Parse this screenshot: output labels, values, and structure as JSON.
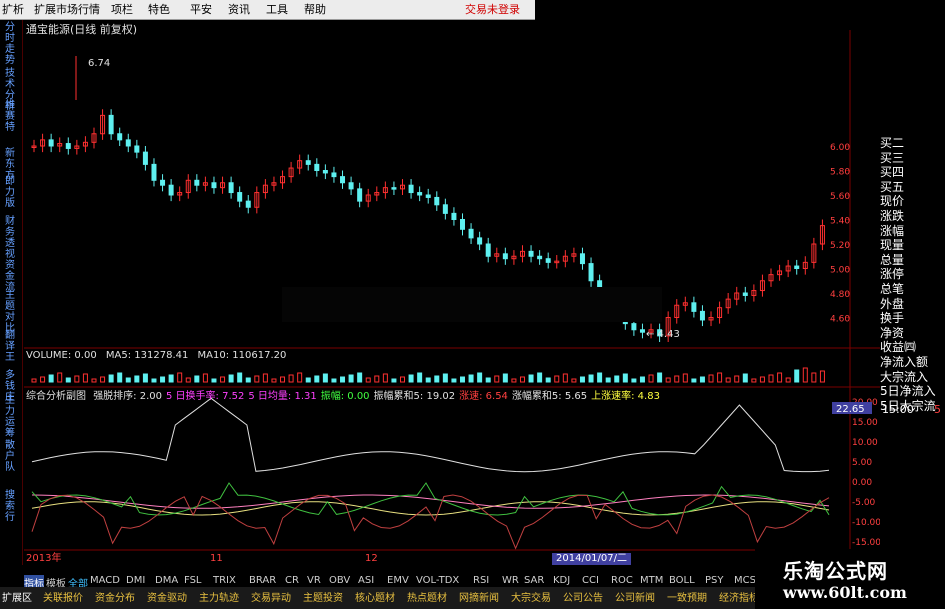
{
  "menubar": {
    "items": [
      "扩析",
      "扩展市场行情",
      "项栏",
      "特色",
      "平安",
      "资讯",
      "工具",
      "帮助"
    ],
    "trade_status": "交易未登录"
  },
  "left_tabs": [
    "分时走势",
    "技术分析",
    "维赛特",
    "新东方",
    "即力版",
    "财务透视",
    "资金流",
    "主题对比",
    "翻译王",
    "多钱庄",
    "主力运筹",
    "散户队",
    "搜索行"
  ],
  "stock": {
    "title": "通宝能源(日线 前复权)"
  },
  "price_chart": {
    "high_label": "6.74",
    "low_label": "4.43",
    "price_ticks": [
      "6.00",
      "5.80",
      "5.60",
      "5.40",
      "5.20",
      "5.00",
      "4.80",
      "4.60"
    ]
  },
  "volume_header": {
    "volume": "VOLUME: 0.00",
    "ma5": "MA5: 131278.41",
    "ma10": "MA10: 110617.20"
  },
  "indicator_header": {
    "name": "综合分析副图",
    "items": [
      "强脱排序: 2.00",
      "5 日换手率: 7.52",
      "5 日均量: 1.31",
      "振幅: 0.00",
      "振幅累和5: 19.02",
      "涨速: 6.54",
      "涨幅累和5: 5.65",
      "上涨速率: 4.83"
    ]
  },
  "indicator_chart": {
    "current": "22.65",
    "ticks": [
      "20.00",
      "15.00",
      "10.00",
      "5.00",
      "0.00",
      "-5.00",
      "-10.00",
      "-15.00"
    ]
  },
  "side_panel": {
    "items": [
      "买二",
      "买三",
      "买四",
      "买五",
      "现价",
      "涨跌",
      "涨幅",
      "现量",
      "总量",
      "涨停",
      "总笔",
      "外盘",
      "换手",
      "净资",
      "收益㈣",
      "净流入额",
      "大宗流入",
      "5日净流入",
      "5日大宗流"
    ],
    "time": "15:00",
    "time_value": "5"
  },
  "date_axis": {
    "left": "2013年",
    "mid1": "11",
    "mid2": "12",
    "highlight": "2014/01/07/二"
  },
  "bottom_tabs1": [
    "指标",
    "模板",
    "全部",
    "MACD",
    "DMI",
    "DMA",
    "FSL",
    "TRIX",
    "BRAR",
    "CR",
    "VR",
    "OBV",
    "ASI",
    "EMV",
    "VOL-TDX",
    "RSI",
    "WR",
    "SAR",
    "KDJ",
    "CCI",
    "ROC",
    "MTM",
    "BOLL",
    "PSY",
    "MCST"
  ],
  "bottom_tabs2": [
    "扩展区",
    "关联报价",
    "资金分布",
    "资金驱动",
    "主力轨迹",
    "交易异动",
    "主题投资",
    "核心题材",
    "热点题材",
    "网摘新闻",
    "大宗交易",
    "公司公告",
    "公司新闻",
    "一致预期",
    "经济指标"
  ],
  "watermark": {
    "line1": "乐淘公式网",
    "line2": "www.60lt.com"
  },
  "colors": {
    "up": "#ff3030",
    "down": "#5ff0f0",
    "axis": "#7a0000",
    "accent": "#e8c040"
  }
}
